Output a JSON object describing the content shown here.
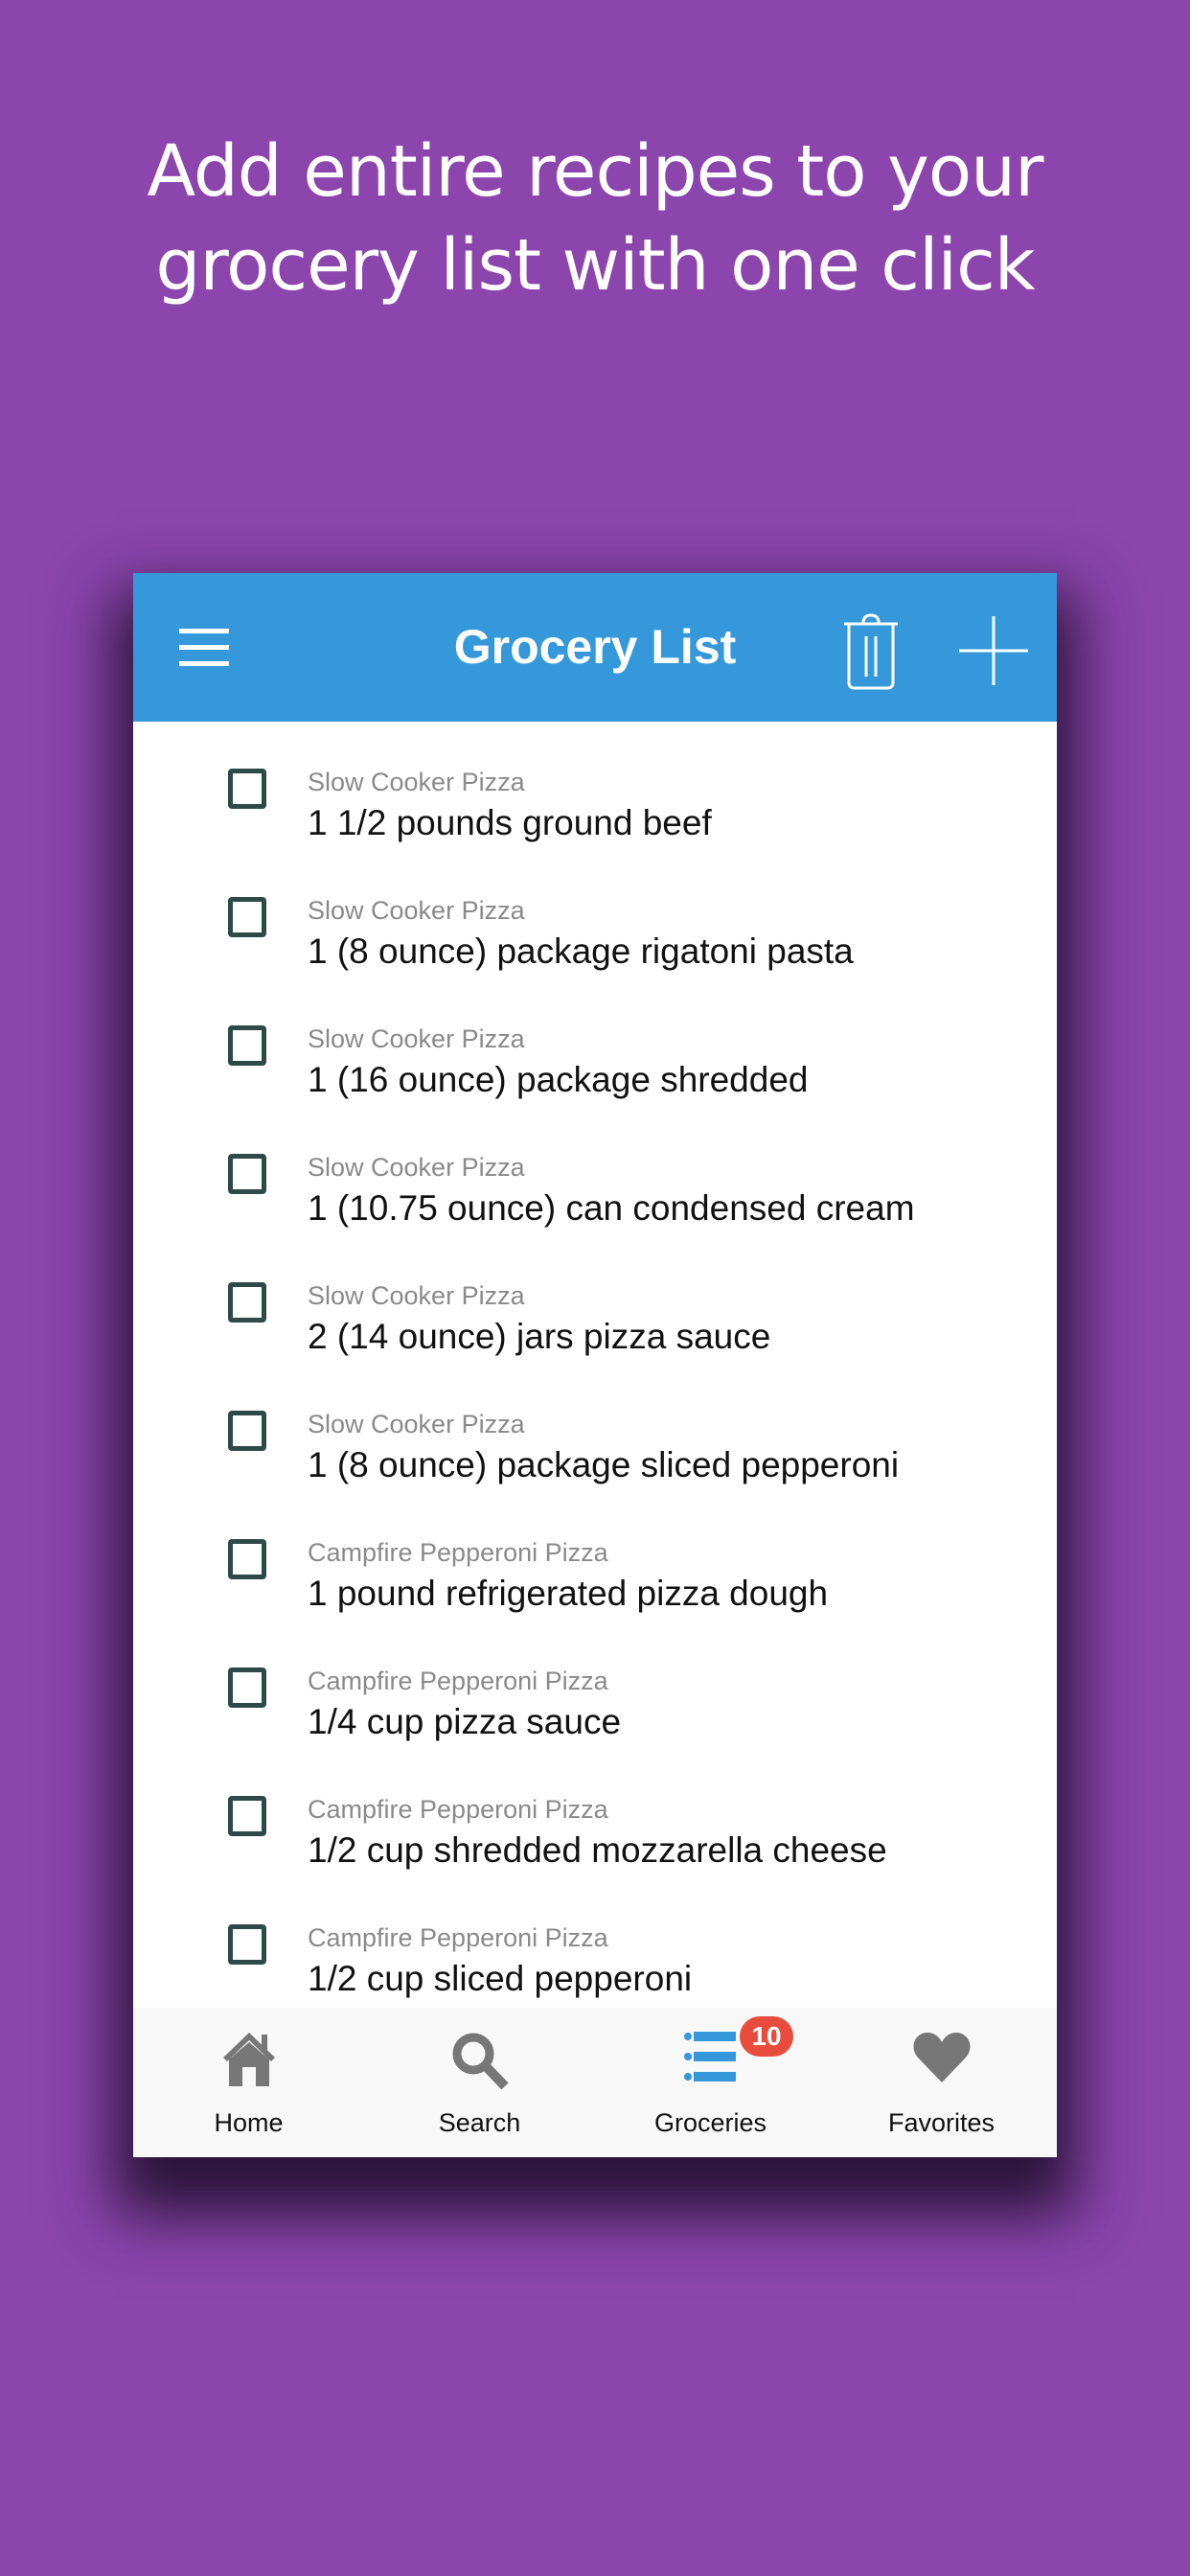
{
  "headline": {
    "line1": "Add entire recipes to your",
    "line2": "grocery list with one click"
  },
  "appbar": {
    "title": "Grocery List",
    "menu_icon": "hamburger-menu-icon",
    "delete_icon": "trash-icon",
    "add_icon": "plus-icon"
  },
  "items": [
    {
      "recipe": "Slow Cooker Pizza",
      "item": "1 1/2 pounds ground beef",
      "checked": false
    },
    {
      "recipe": "Slow Cooker Pizza",
      "item": "1 (8 ounce) package rigatoni pasta",
      "checked": false
    },
    {
      "recipe": "Slow Cooker Pizza",
      "item": "1 (16 ounce) package shredded",
      "checked": false
    },
    {
      "recipe": "Slow Cooker Pizza",
      "item": "1 (10.75 ounce) can condensed cream",
      "checked": false
    },
    {
      "recipe": "Slow Cooker Pizza",
      "item": "2 (14 ounce) jars pizza sauce",
      "checked": false
    },
    {
      "recipe": "Slow Cooker Pizza",
      "item": "1 (8 ounce) package sliced pepperoni",
      "checked": false
    },
    {
      "recipe": "Campfire Pepperoni Pizza",
      "item": "1 pound refrigerated pizza dough",
      "checked": false
    },
    {
      "recipe": "Campfire Pepperoni Pizza",
      "item": "1/4 cup pizza sauce",
      "checked": false
    },
    {
      "recipe": "Campfire Pepperoni Pizza",
      "item": "1/2 cup shredded mozzarella cheese",
      "checked": false
    },
    {
      "recipe": "Campfire Pepperoni Pizza",
      "item": "1/2 cup sliced pepperoni",
      "checked": false
    }
  ],
  "bottom_nav": {
    "tabs": [
      {
        "label": "Home",
        "icon": "home-icon",
        "active": false
      },
      {
        "label": "Search",
        "icon": "search-icon",
        "active": false
      },
      {
        "label": "Groceries",
        "icon": "list-icon",
        "active": true
      },
      {
        "label": "Favorites",
        "icon": "heart-icon",
        "active": false
      }
    ],
    "groceries_badge": "10"
  },
  "colors": {
    "background": "#8b45ad",
    "appbar": "#3598db",
    "active_tab": "#3598db",
    "inactive_tab": "#777777",
    "badge": "#e74c3c",
    "checkbox_border": "#2e4a47"
  }
}
